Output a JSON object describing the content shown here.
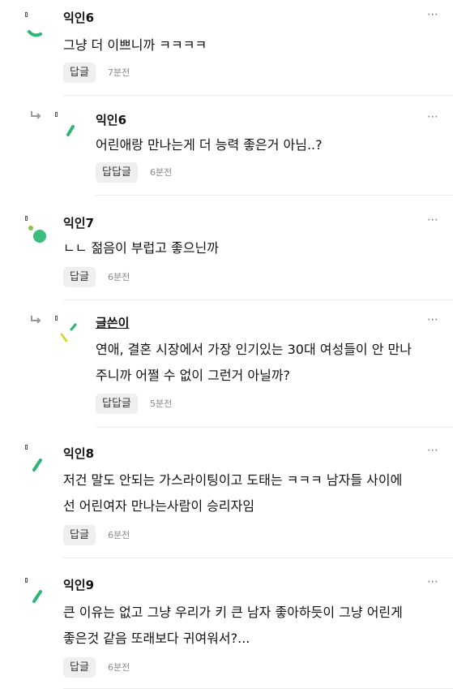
{
  "comments": [
    {
      "author": "익인6",
      "lines": [
        "그냥 더 이쁘니까 ㅋㅋㅋㅋ"
      ],
      "reply_label": "답글",
      "time": "7분전",
      "more": "⋯"
    },
    {
      "author": "익인6",
      "lines": [
        "어린애랑 만나는게 더 능력 좋은거 아님..?"
      ],
      "reply_label": "답답글",
      "time": "6분전",
      "more": "⋯"
    },
    {
      "author": "익인7",
      "lines": [
        "ㄴㄴ 젊음이 부럽고 좋으닌까"
      ],
      "reply_label": "답글",
      "time": "6분전",
      "more": "⋯"
    },
    {
      "author": "글쓴이",
      "lines": [
        "연애, 결혼 시장에서 가장 인기있는 30대 여성들이 안 만나",
        "주니까 어쩔 수 없이 그런거 아닐까?"
      ],
      "reply_label": "답답글",
      "time": "5분전",
      "more": "⋯"
    },
    {
      "author": "익인8",
      "lines": [
        "저건 말도 안되는 가스라이팅이고 도태는 ㅋㅋㅋ 남자들 사이에",
        "선 어린여자 만나는사람이 승리자임"
      ],
      "reply_label": "답글",
      "time": "6분전",
      "more": "⋯"
    },
    {
      "author": "익인9",
      "lines": [
        "큰 이유는 없고 그냥 우리가 키 큰 남자 좋아하듯이 그냥 어린게",
        "좋은것 같음 또래보다 귀여워서?..."
      ],
      "reply_label": "답글",
      "time": "6분전",
      "more": "⋯"
    }
  ],
  "colors": {
    "accent_green": "#2bb673",
    "divider": "#ececec",
    "button_bg": "#efefef"
  },
  "icons": [
    "avatar-mark-icon",
    "reply-arrow-icon",
    "more-options-icon"
  ]
}
